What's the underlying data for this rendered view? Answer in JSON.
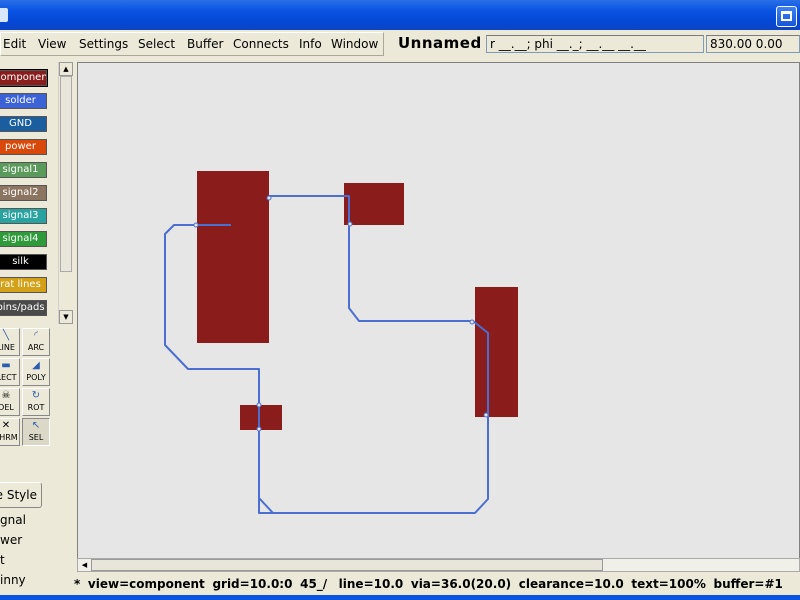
{
  "menu": {
    "items": [
      "Edit",
      "View",
      "Settings",
      "Select",
      "Buffer",
      "Connects",
      "Info",
      "Window"
    ]
  },
  "document": {
    "title": "Unnamed"
  },
  "readouts": {
    "rphi": "r __.__; phi __._; __.__ __.__",
    "coords": "830.00 0.00"
  },
  "layers": [
    {
      "label": "component",
      "color": "#8b1c1c"
    },
    {
      "label": "solder",
      "color": "#3b63d6"
    },
    {
      "label": "GND",
      "color": "#1a5ea0"
    },
    {
      "label": "power",
      "color": "#d94a0a"
    },
    {
      "label": "signal1",
      "color": "#5a9a5a"
    },
    {
      "label": "signal2",
      "color": "#8b7560"
    },
    {
      "label": "signal3",
      "color": "#2aa3a0"
    },
    {
      "label": "signal4",
      "color": "#2f9a3a"
    },
    {
      "label": "silk",
      "color": "#000000"
    },
    {
      "label": "rat lines",
      "color": "#d4a017"
    },
    {
      "label": "pins/pads",
      "color": "#4a4a4a"
    }
  ],
  "tools": [
    {
      "label": "LINE",
      "icon": "line-icon"
    },
    {
      "label": "ARC",
      "icon": "arc-icon"
    },
    {
      "label": "RECT",
      "icon": "rect-icon"
    },
    {
      "label": "POLY",
      "icon": "poly-icon"
    },
    {
      "label": "DEL",
      "icon": "skull-icon"
    },
    {
      "label": "ROT",
      "icon": "rotate-icon"
    },
    {
      "label": "THRM",
      "icon": "thermal-icon"
    },
    {
      "label": "SEL",
      "icon": "cursor-icon"
    }
  ],
  "route": {
    "button_label": "e Style",
    "options": [
      "gnal",
      "wer",
      "t",
      "inny"
    ]
  },
  "status": {
    "prefix": "*",
    "view_label": "view=",
    "view": "component",
    "grid_label": "grid=",
    "grid": "10.0:0",
    "angle": "45_/",
    "line_label": "line=",
    "line": "10.0",
    "via_label": "via=",
    "via": "36.0(20.0)",
    "clearance_label": "clearance=",
    "clearance": "10.0",
    "text_label": "text=",
    "text": "100%",
    "buffer_label": "buffer=",
    "buffer": "#1"
  },
  "colors": {
    "pad": "#8b1c1c",
    "trace": "#4a6fd0",
    "canvas": "#e6e6e6",
    "titlebar": "#0a54e3"
  }
}
